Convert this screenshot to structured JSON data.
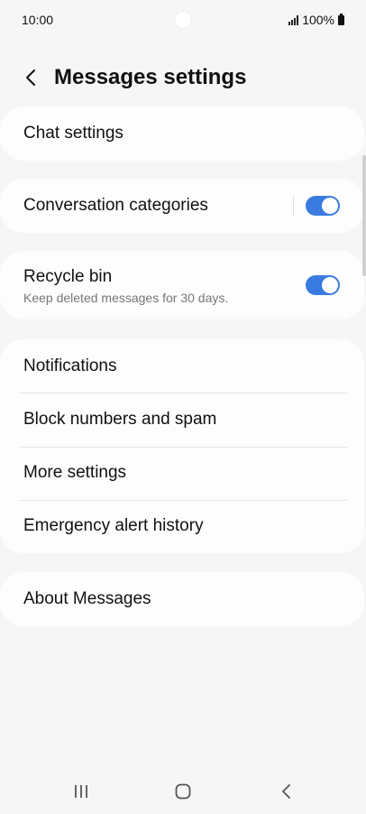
{
  "status_bar": {
    "time": "10:00",
    "battery_text": "100%"
  },
  "header": {
    "title": "Messages settings",
    "back_icon": "chevron-left-icon"
  },
  "settings": {
    "chat_settings": "Chat settings",
    "conversation_categories": {
      "label": "Conversation categories",
      "enabled": true
    },
    "recycle_bin": {
      "label": "Recycle bin",
      "subtitle": "Keep deleted messages for 30 days.",
      "enabled": true
    },
    "notifications": "Notifications",
    "block_numbers": "Block numbers and spam",
    "more_settings": "More settings",
    "emergency_alert_history": "Emergency alert history",
    "about_messages": "About Messages"
  },
  "colors": {
    "toggle_on": "#3a7be0",
    "background": "#f6f6f6",
    "card": "#fdfdfd"
  },
  "nav_bar": {
    "recents_icon": "recents-icon",
    "home_icon": "home-icon",
    "back_icon": "back-icon"
  }
}
